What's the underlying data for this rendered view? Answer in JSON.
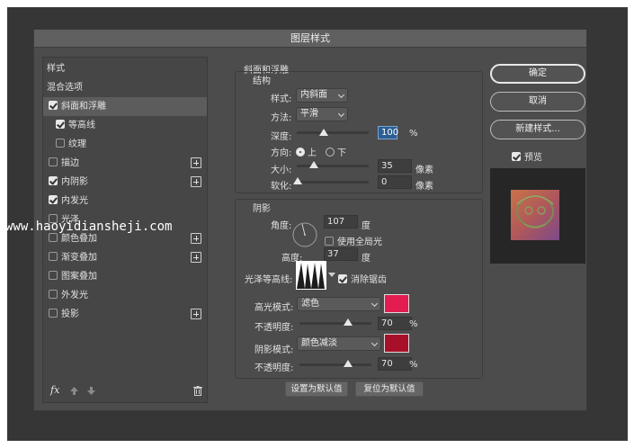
{
  "window": {
    "title": "图层样式"
  },
  "left_panel": {
    "header_styles": "样式",
    "header_blend": "混合选项",
    "items": [
      {
        "label": "斜面和浮雕",
        "checked": true
      },
      {
        "label": "等高线",
        "checked": true
      },
      {
        "label": "纹理",
        "checked": false
      },
      {
        "label": "描边",
        "checked": false
      },
      {
        "label": "内阴影",
        "checked": true
      },
      {
        "label": "内发光",
        "checked": true
      },
      {
        "label": "光泽",
        "checked": false
      },
      {
        "label": "颜色叠加",
        "checked": false
      },
      {
        "label": "渐变叠加",
        "checked": false
      },
      {
        "label": "图案叠加",
        "checked": false
      },
      {
        "label": "外发光",
        "checked": false
      },
      {
        "label": "投影",
        "checked": false
      }
    ],
    "fx_label": "fx"
  },
  "bevel": {
    "section_title": "斜面和浮雕",
    "structure_title": "结构",
    "style_label": "样式:",
    "style_value": "内斜面",
    "technique_label": "方法:",
    "technique_value": "平滑",
    "depth_label": "深度:",
    "depth_value": "100",
    "depth_unit": "%",
    "direction_label": "方向:",
    "direction_up": "上",
    "direction_down": "下",
    "size_label": "大小:",
    "size_value": "35",
    "size_unit": "像素",
    "soften_label": "软化:",
    "soften_value": "0",
    "soften_unit": "像素"
  },
  "shading": {
    "title": "阴影",
    "angle_label": "角度:",
    "angle_value": "107",
    "angle_unit": "度",
    "global_light_label": "使用全局光",
    "altitude_label": "高度:",
    "altitude_value": "37",
    "altitude_unit": "度",
    "gloss_label": "光泽等高线:",
    "antialias_label": "消除锯齿",
    "highlight_mode_label": "高光模式:",
    "highlight_mode_value": "滤色",
    "highlight_color": "#e31d4f",
    "highlight_opacity_label": "不透明度:",
    "highlight_opacity_value": "70",
    "highlight_opacity_unit": "%",
    "shadow_mode_label": "阴影模式:",
    "shadow_mode_value": "颜色减淡",
    "shadow_color": "#a8102a",
    "shadow_opacity_label": "不透明度:",
    "shadow_opacity_value": "70",
    "shadow_opacity_unit": "%"
  },
  "bottom_buttons": {
    "set_default": "设置为默认值",
    "reset_default": "复位为默认值"
  },
  "right_buttons": {
    "ok": "确定",
    "cancel": "取消",
    "new_style": "新建样式...",
    "preview_label": "预览"
  },
  "watermark": "www.haoyidiansheji.com"
}
